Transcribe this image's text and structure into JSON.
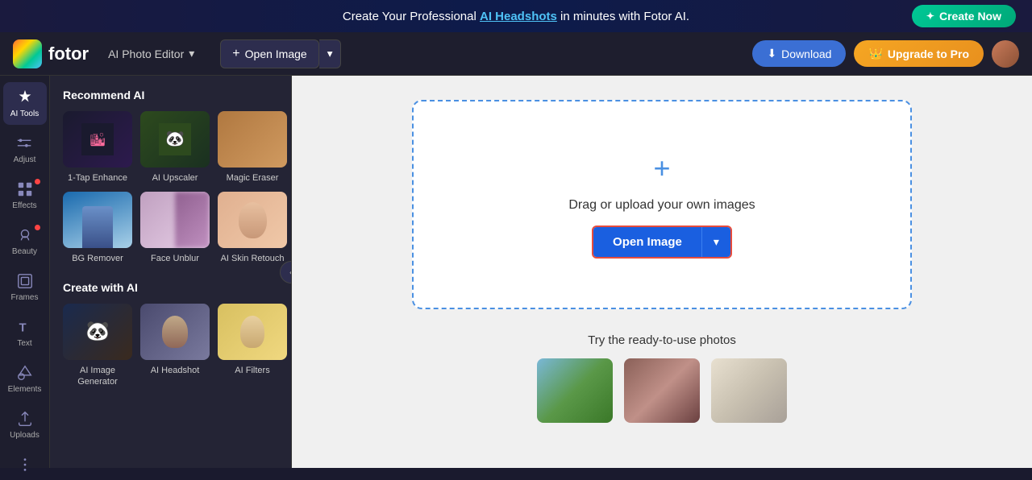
{
  "banner": {
    "text_before": "Create Your Professional ",
    "highlight": "AI Headshots",
    "text_after": " in minutes with Fotor AI.",
    "cta_label": "Create Now"
  },
  "header": {
    "logo_text": "fotor",
    "ai_editor_label": "AI Photo Editor",
    "open_image_label": "Open Image",
    "download_label": "Download",
    "upgrade_label": "Upgrade to Pro"
  },
  "sidebar_icons": [
    {
      "id": "ai-tools",
      "label": "AI Tools",
      "active": true,
      "has_dot": false
    },
    {
      "id": "adjust",
      "label": "Adjust",
      "active": false,
      "has_dot": false
    },
    {
      "id": "effects",
      "label": "Effects",
      "active": false,
      "has_dot": true
    },
    {
      "id": "beauty",
      "label": "Beauty",
      "active": false,
      "has_dot": true
    },
    {
      "id": "frames",
      "label": "Frames",
      "active": false,
      "has_dot": false
    },
    {
      "id": "text",
      "label": "Text",
      "active": false,
      "has_dot": false
    },
    {
      "id": "elements",
      "label": "Elements",
      "active": false,
      "has_dot": false
    },
    {
      "id": "uploads",
      "label": "Uploads",
      "active": false,
      "has_dot": false
    }
  ],
  "ai_panel": {
    "recommend_title": "Recommend AI",
    "recommend_items": [
      {
        "id": "1tap",
        "label": "1-Tap Enhance",
        "thumb": "1tap"
      },
      {
        "id": "upscaler",
        "label": "AI Upscaler",
        "thumb": "panda"
      },
      {
        "id": "eraser",
        "label": "Magic Eraser",
        "thumb": "eraser"
      },
      {
        "id": "bg-remover",
        "label": "BG Remover",
        "thumb": "bg"
      },
      {
        "id": "face-unblur",
        "label": "Face Unblur",
        "thumb": "unblur"
      },
      {
        "id": "skin-retouch",
        "label": "AI Skin Retouch",
        "thumb": "skin"
      }
    ],
    "create_title": "Create with AI",
    "create_items": [
      {
        "id": "img-gen",
        "label": "AI Image Generator",
        "thumb": "img-gen"
      },
      {
        "id": "headshot",
        "label": "AI Headshot",
        "thumb": "headshot"
      },
      {
        "id": "filters",
        "label": "AI Filters",
        "thumb": "filters"
      }
    ]
  },
  "canvas": {
    "upload_text": "Drag or upload your own images",
    "open_image_label": "Open Image",
    "ready_title": "Try the ready-to-use photos"
  }
}
